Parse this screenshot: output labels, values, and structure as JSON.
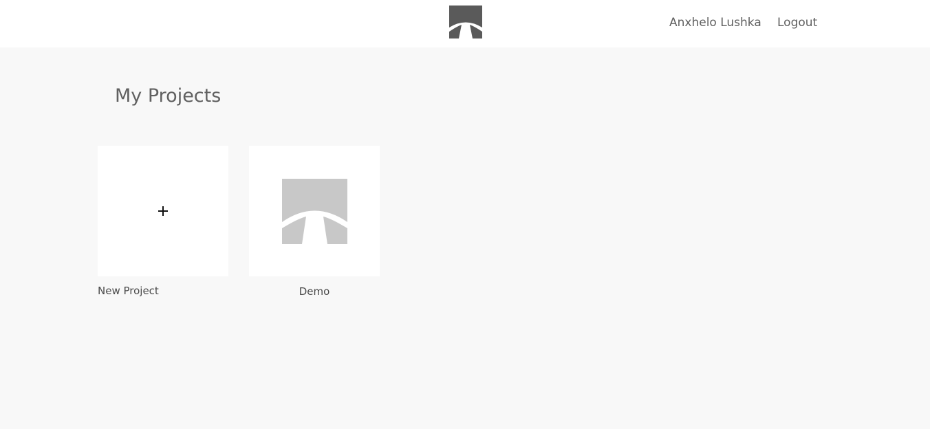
{
  "header": {
    "logo_icon": "app-logo-icon",
    "user_name": "Anxhelo Lushka",
    "logout_label": "Logout"
  },
  "main": {
    "title": "My Projects",
    "new_project": {
      "label": "New Project",
      "icon": "plus-icon"
    },
    "projects": [
      {
        "name": "Demo",
        "thumbnail_icon": "project-logo-icon"
      }
    ]
  },
  "colors": {
    "header_bg": "#ffffff",
    "page_bg": "#f8f8f8",
    "logo": "#5a5a5a",
    "thumbnail": "#c8c8c8"
  }
}
